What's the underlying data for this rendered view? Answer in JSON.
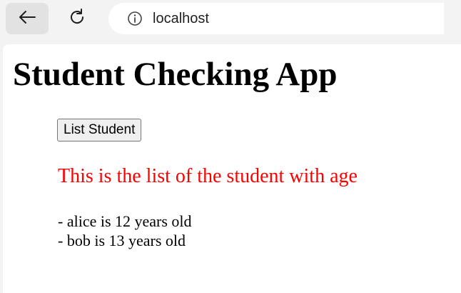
{
  "browser": {
    "url": "localhost",
    "back_icon": "back-arrow-icon",
    "reload_icon": "reload-icon",
    "info_icon": "info-icon"
  },
  "page": {
    "title": "Student Checking App",
    "list_button_label": "List Student",
    "list_heading": "This is the list of the student with age",
    "heading_color": "#ff0000",
    "students": [
      "- alice is 12 years old",
      "- bob is 13 years old"
    ]
  }
}
